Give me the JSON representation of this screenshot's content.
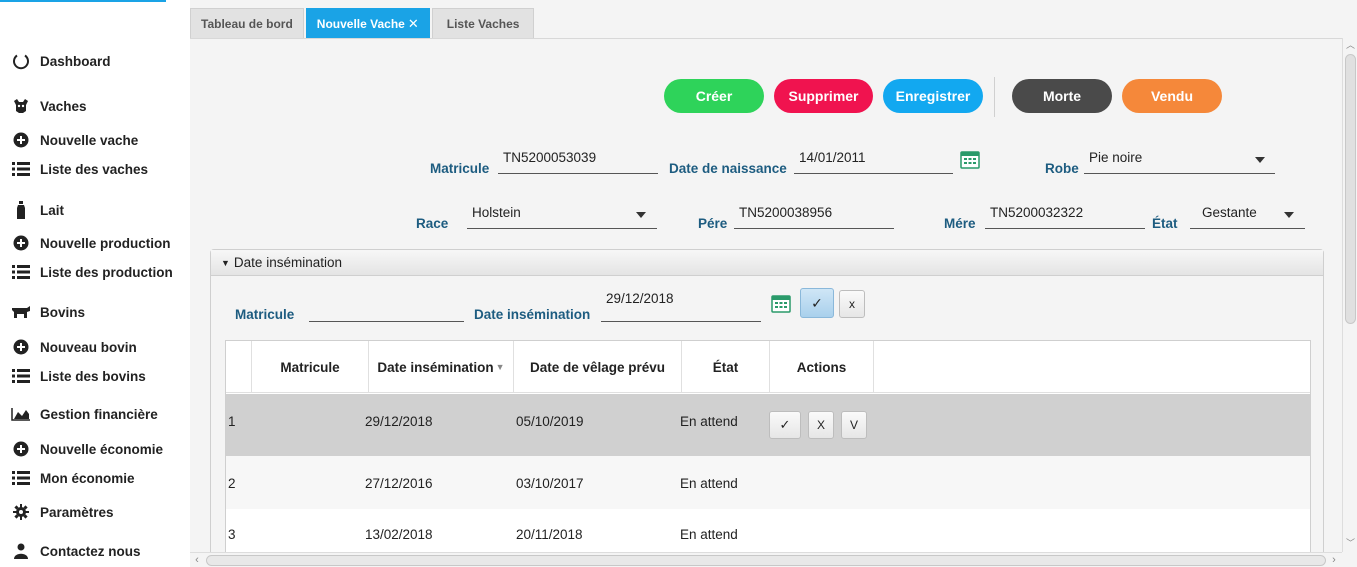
{
  "sidebar": {
    "items": [
      {
        "label": "Dashboard",
        "icon": "circle-icon"
      },
      {
        "label": "Vaches",
        "icon": "cow-icon"
      },
      {
        "label": "Nouvelle vache",
        "icon": "plus-circle-icon"
      },
      {
        "label": "Liste des vaches",
        "icon": "list-icon"
      },
      {
        "label": "Lait",
        "icon": "milk-bottle-icon"
      },
      {
        "label": "Nouvelle production",
        "icon": "plus-circle-icon"
      },
      {
        "label": "Liste des production",
        "icon": "list-icon"
      },
      {
        "label": "Bovins",
        "icon": "bovine-icon"
      },
      {
        "label": "Nouveau bovin",
        "icon": "plus-circle-icon"
      },
      {
        "label": "Liste des bovins",
        "icon": "list-icon"
      },
      {
        "label": "Gestion financière",
        "icon": "area-chart-icon"
      },
      {
        "label": "Nouvelle économie",
        "icon": "plus-circle-icon"
      },
      {
        "label": "Mon économie",
        "icon": "list-icon"
      },
      {
        "label": "Paramètres",
        "icon": "gear-icon"
      },
      {
        "label": "Contactez nous",
        "icon": "user-icon"
      }
    ]
  },
  "tabs": [
    {
      "label": "Tableau de bord"
    },
    {
      "label": "Nouvelle Vache",
      "close": "✕"
    },
    {
      "label": "Liste Vaches"
    }
  ],
  "actions": {
    "creer": "Créer",
    "supprimer": "Supprimer",
    "enregistrer": "Enregistrer",
    "morte": "Morte",
    "vendu": "Vendu"
  },
  "colors": {
    "accent": "#1aa3e6",
    "creer": "#2ed35a",
    "supprimer": "#f0134f",
    "enregistrer": "#12a8f0",
    "morte": "#4a4a4a",
    "vendu": "#f5883a",
    "label": "#1d5c80"
  },
  "form": {
    "matricule_label": "Matricule",
    "matricule_value": "TN5200053039",
    "naissance_label": "Date de naissance",
    "naissance_value": "14/01/2011",
    "robe_label": "Robe",
    "robe_value": "Pie noire",
    "race_label": "Race",
    "race_value": "Holstein",
    "pere_label": "Pére",
    "pere_value": "TN5200038956",
    "mere_label": "Mére",
    "mere_value": "TN5200032322",
    "etat_label": "État",
    "etat_value": "Gestante"
  },
  "panel": {
    "title": "Date insémination",
    "matricule_label": "Matricule",
    "matricule_value": "",
    "date_label": "Date insémination",
    "date_value": "29/12/2018",
    "confirm": "✓",
    "cancel": "x"
  },
  "table": {
    "columns": [
      "",
      "Matricule",
      "Date insémination",
      "Date de vêlage prévu",
      "État",
      "Actions"
    ],
    "sort_indicator": "▼",
    "rows": [
      {
        "num": "1",
        "matricule": "",
        "date_ins": "29/12/2018",
        "date_vel": "05/10/2019",
        "etat": "En attend",
        "actions": [
          "✓",
          "X",
          "V"
        ]
      },
      {
        "num": "2",
        "matricule": "",
        "date_ins": "27/12/2016",
        "date_vel": "03/10/2017",
        "etat": "En attend"
      },
      {
        "num": "3",
        "matricule": "",
        "date_ins": "13/02/2018",
        "date_vel": "20/11/2018",
        "etat": "En attend"
      }
    ]
  }
}
